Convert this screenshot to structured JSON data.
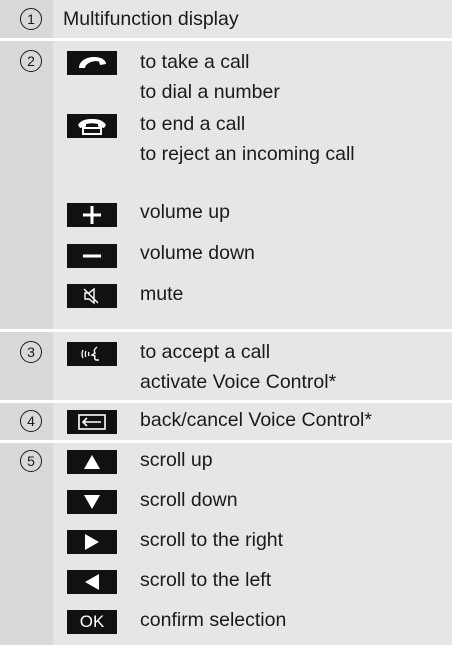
{
  "rows": [
    {
      "number": "1",
      "title": "Multifunction display"
    },
    {
      "number": "2",
      "items": [
        {
          "icon": "phone-pickup-icon",
          "lines": [
            "to take a call",
            "to dial a number"
          ]
        },
        {
          "icon": "phone-hangup-icon",
          "lines": [
            "to end a call",
            "to reject an incoming call"
          ]
        },
        {
          "icon": "plus-icon",
          "lines": [
            "volume up"
          ]
        },
        {
          "icon": "minus-icon",
          "lines": [
            "volume down"
          ]
        },
        {
          "icon": "mute-speaker-icon",
          "lines": [
            "mute"
          ]
        }
      ]
    },
    {
      "number": "3",
      "items": [
        {
          "icon": "voice-control-icon",
          "lines": [
            "to accept a call",
            "activate Voice Control*"
          ]
        }
      ]
    },
    {
      "number": "4",
      "items": [
        {
          "icon": "back-arrow-icon",
          "lines": [
            "back/cancel Voice Control*"
          ]
        }
      ]
    },
    {
      "number": "5",
      "items": [
        {
          "icon": "triangle-up-icon",
          "lines": [
            "scroll up"
          ]
        },
        {
          "icon": "triangle-down-icon",
          "lines": [
            "scroll down"
          ]
        },
        {
          "icon": "triangle-right-icon",
          "lines": [
            "scroll to the right"
          ]
        },
        {
          "icon": "triangle-left-icon",
          "lines": [
            "scroll to the left"
          ]
        },
        {
          "icon": "ok-button-icon",
          "label": "OK",
          "lines": [
            "confirm selection"
          ]
        }
      ]
    }
  ]
}
